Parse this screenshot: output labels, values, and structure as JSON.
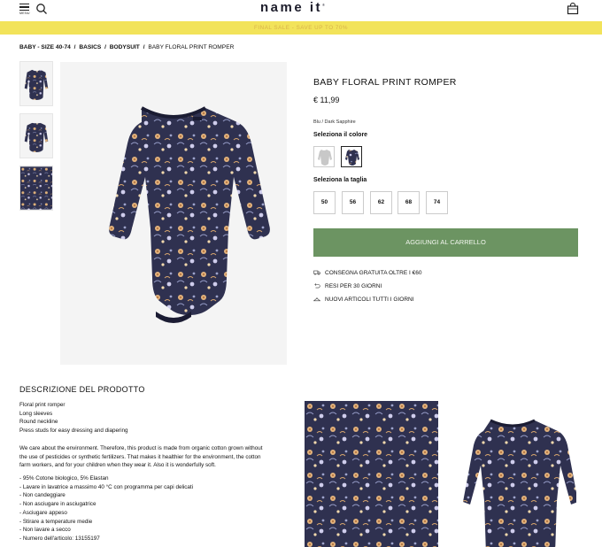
{
  "header": {
    "menu_label": "MENU",
    "logo": "name it",
    "logo_mark": "®"
  },
  "promo": {
    "text": "FINAL SALE - SAVE UP TO 70%"
  },
  "breadcrumb": {
    "items": [
      "BABY - SIZE 40-74",
      "BASICS",
      "BODYSUIT"
    ],
    "separator": "/",
    "current": "BABY FLORAL PRINT ROMPER"
  },
  "product": {
    "title": "BABY FLORAL PRINT ROMPER",
    "price": "€ 11,99",
    "color_name": "Blu / Dark Sapphire",
    "color_label": "Seleziona il colore",
    "size_label": "Seleziona la taglia",
    "sizes": [
      "50",
      "56",
      "62",
      "68",
      "74"
    ],
    "add_to_cart": "AGGIUNGI AL CARRELLO",
    "info": [
      "CONSEGNA GRATUITA OLTRE I €60",
      "RESI PER 30 GIORNI",
      "NUOVI ARTICOLI TUTTI I GIORNI"
    ]
  },
  "description": {
    "title": "DESCRIZIONE DEL PRODOTTO",
    "features": [
      "Floral print romper",
      "Long sleeves",
      "Round neckline",
      "Press studs for easy dressing and diapering"
    ],
    "paragraph": [
      "We care about the environment. Therefore, this product is made from organic cotton grown without",
      "the use of pesticides or synthetic fertilizers. That makes it healthier for the environment, the cotton",
      "farm workers, and for your children when they wear it. Also it is wonderfully soft."
    ],
    "care": [
      "- 95% Cotone biologico, 5% Elastan",
      "- Lavare in lavatrice a massimo 40 °C con programma per capi delicati",
      "- Non candeggiare",
      "- Non asciugare in asciugatrice",
      "- Asciugare appeso",
      "- Stirare a temperature medie",
      "- Non lavare a secco",
      "- Numero dell'articolo: 13155197"
    ]
  },
  "colors": {
    "garment_base": "#2f3150",
    "add_button": "#6c9462",
    "promo_bg": "#f2e35a"
  }
}
